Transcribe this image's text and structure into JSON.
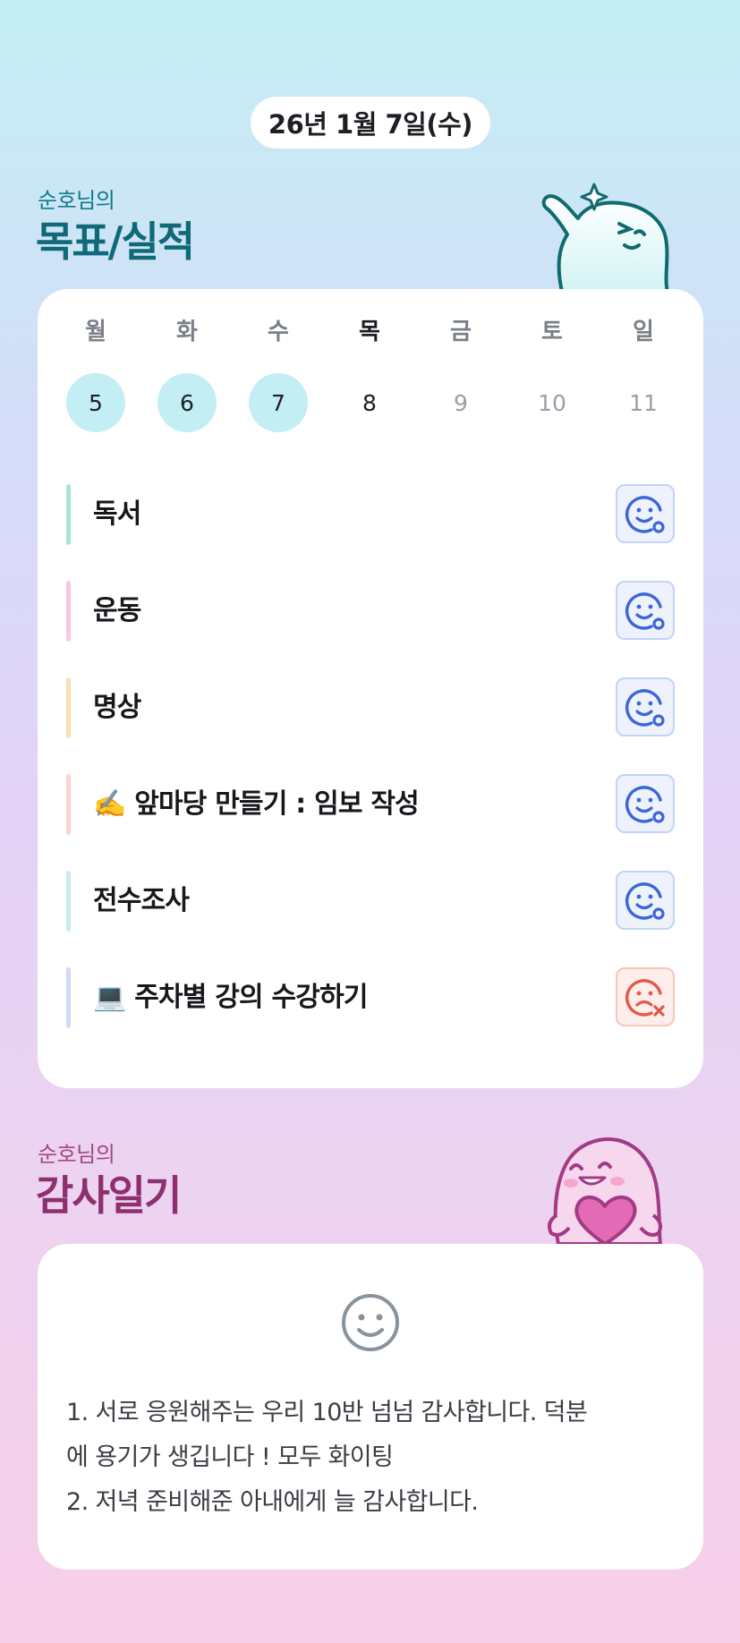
{
  "date_label": "26년 1월 7일(수)",
  "goals_section": {
    "subtitle": "순호님의",
    "title": "목표/실적"
  },
  "week": [
    {
      "day": "월",
      "date": "5",
      "state": "done"
    },
    {
      "day": "화",
      "date": "6",
      "state": "done"
    },
    {
      "day": "수",
      "date": "7",
      "state": "done"
    },
    {
      "day": "목",
      "date": "8",
      "state": "today"
    },
    {
      "day": "금",
      "date": "9",
      "state": "future"
    },
    {
      "day": "토",
      "date": "10",
      "state": "future"
    },
    {
      "day": "일",
      "date": "11",
      "state": "future"
    }
  ],
  "goals": [
    {
      "label": "독서",
      "bar_color": "#a9e6cf",
      "status": "achieved",
      "icon": "smile-check-icon"
    },
    {
      "label": "운동",
      "bar_color": "#f9c7e3",
      "status": "achieved",
      "icon": "smile-check-icon"
    },
    {
      "label": "명상",
      "bar_color": "#fbe0b1",
      "status": "achieved",
      "icon": "smile-check-icon"
    },
    {
      "label": "✍️ 앞마당 만들기 : 임보 작성",
      "bar_color": "#fcd3d3",
      "status": "achieved",
      "icon": "smile-check-icon"
    },
    {
      "label": "전수조사",
      "bar_color": "#c6ecf0",
      "status": "achieved",
      "icon": "smile-check-icon"
    },
    {
      "label": "💻 주차별 강의 수강하기",
      "bar_color": "#d1dbf6",
      "status": "missed",
      "icon": "sad-x-icon"
    }
  ],
  "gratitude_section": {
    "subtitle": "순호님의",
    "title": "감사일기"
  },
  "gratitude": {
    "mood_icon": "smile-face-icon",
    "text": "1. 서로 응원해주는 우리 10반 넘넘 감사합니다. 덕분\n에 용기가 생깁니다 ! 모두 화이팅\n2. 저녁 준비해준 아내에게 늘 감사합니다."
  },
  "colors": {
    "achieved_icon": "#3a66d8",
    "missed_icon": "#e05a4a",
    "done_day_bg": "#c3eef4"
  }
}
